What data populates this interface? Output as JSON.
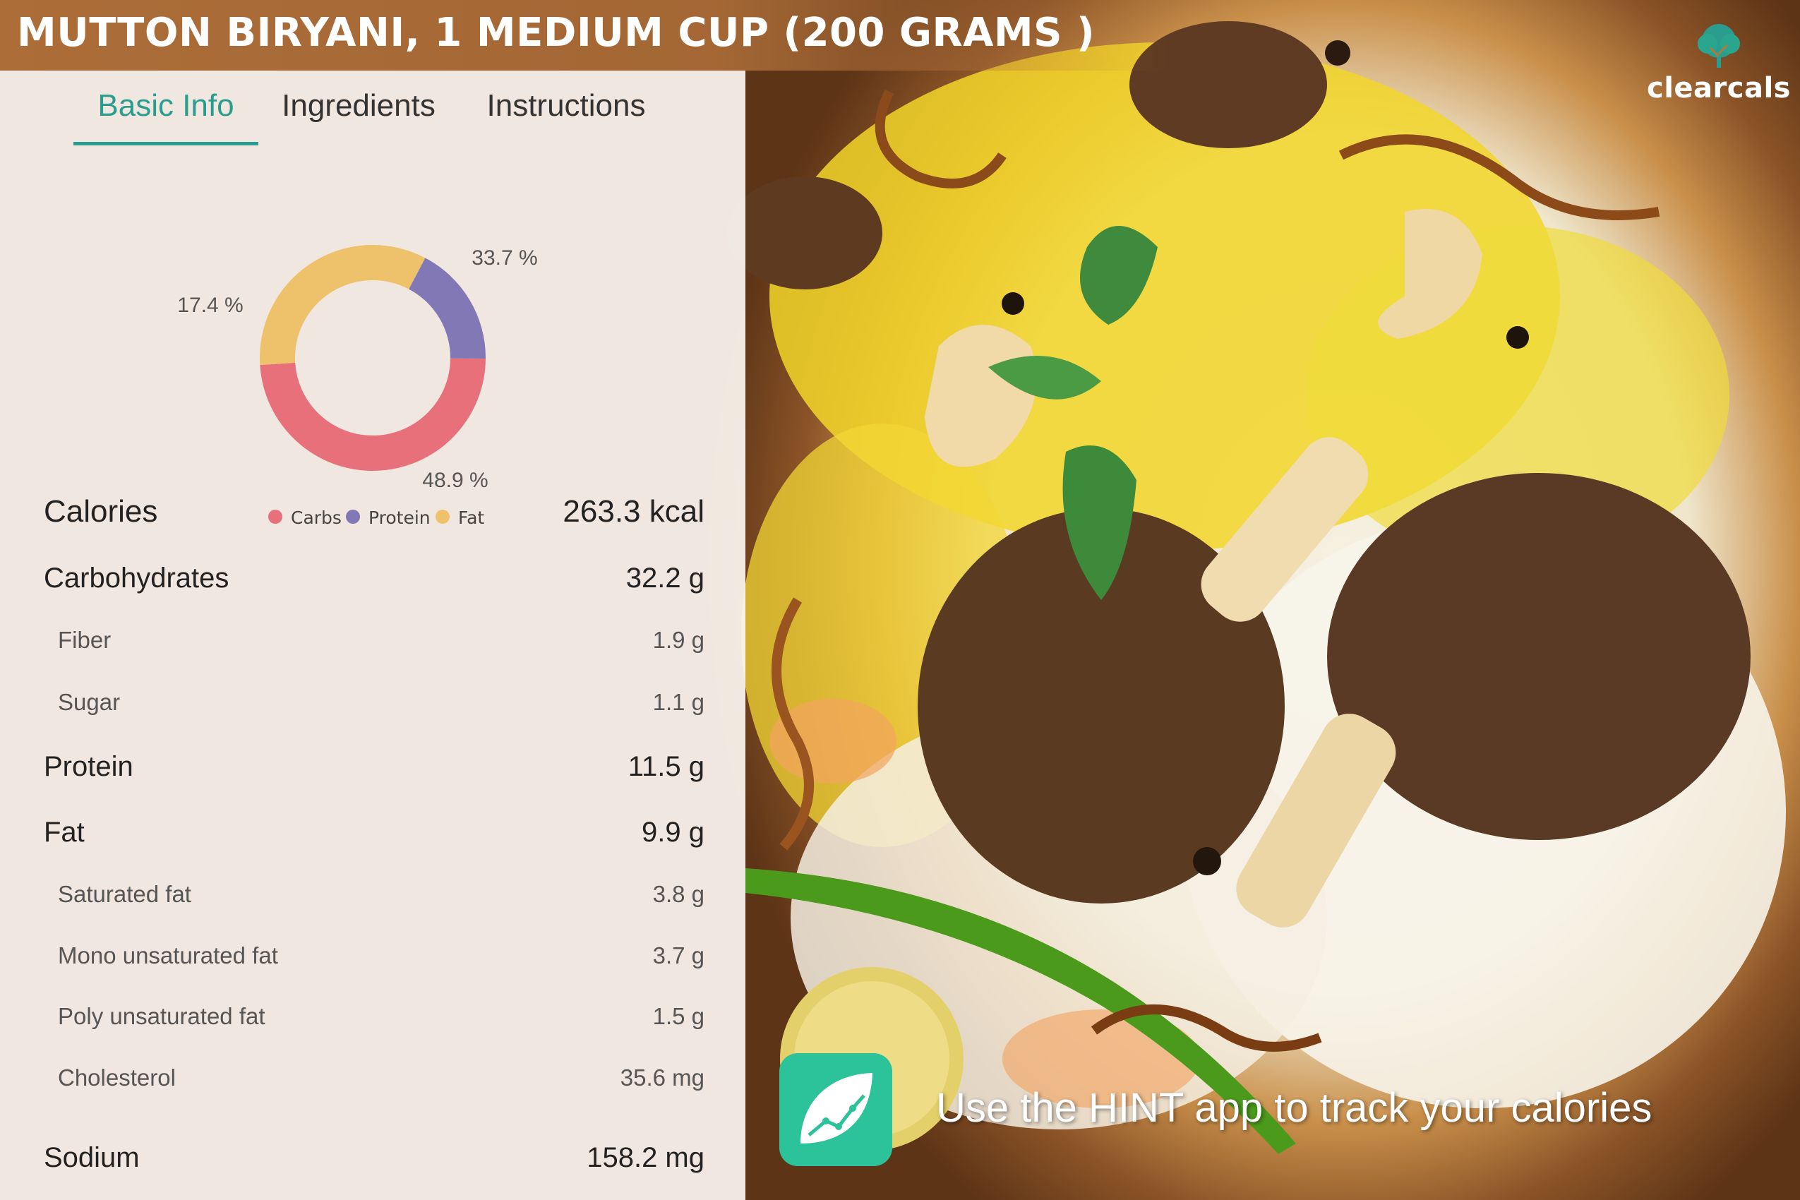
{
  "page": {
    "title": "MUTTON BIRYANI, 1 MEDIUM CUP (200 GRAMS )"
  },
  "brand": {
    "name": "clearcals",
    "icon": "tree-logo-icon",
    "color": "#2a9d8f"
  },
  "tabs": [
    {
      "label": "Basic Info",
      "active": true
    },
    {
      "label": "Ingredients",
      "active": false
    },
    {
      "label": "Instructions",
      "active": false
    }
  ],
  "chart_data": {
    "type": "pie",
    "donut": true,
    "categories": [
      "Carbs",
      "Protein",
      "Fat"
    ],
    "values": [
      48.9,
      17.4,
      33.7
    ],
    "labels": [
      "48.9 %",
      "17.4 %",
      "33.7 %"
    ],
    "colors": [
      "#e8707b",
      "#8278b6",
      "#eec26a"
    ],
    "legend": "bottom"
  },
  "nutrition": [
    {
      "label": "Calories",
      "value": "263.3 kcal",
      "level": "big"
    },
    {
      "label": "Carbohydrates",
      "value": "32.2 g",
      "level": "major"
    },
    {
      "label": "Fiber",
      "value": "1.9 g",
      "level": "minor"
    },
    {
      "label": "Sugar",
      "value": "1.1 g",
      "level": "minor"
    },
    {
      "label": "Protein",
      "value": "11.5 g",
      "level": "major"
    },
    {
      "label": "Fat",
      "value": "9.9 g",
      "level": "major"
    },
    {
      "label": "Saturated fat",
      "value": "3.8 g",
      "level": "minor"
    },
    {
      "label": "Mono unsaturated fat",
      "value": "3.7 g",
      "level": "minor"
    },
    {
      "label": "Poly unsaturated fat",
      "value": "1.5 g",
      "level": "minor"
    },
    {
      "label": "Cholesterol",
      "value": "35.6 mg",
      "level": "minor"
    },
    {
      "label": "Sodium",
      "value": "158.2 mg",
      "level": "major"
    }
  ],
  "promo": {
    "text": "Use the HINT app to track your calories",
    "icon": "hint-leaf-chart-icon",
    "icon_color": "#2cc39a"
  }
}
